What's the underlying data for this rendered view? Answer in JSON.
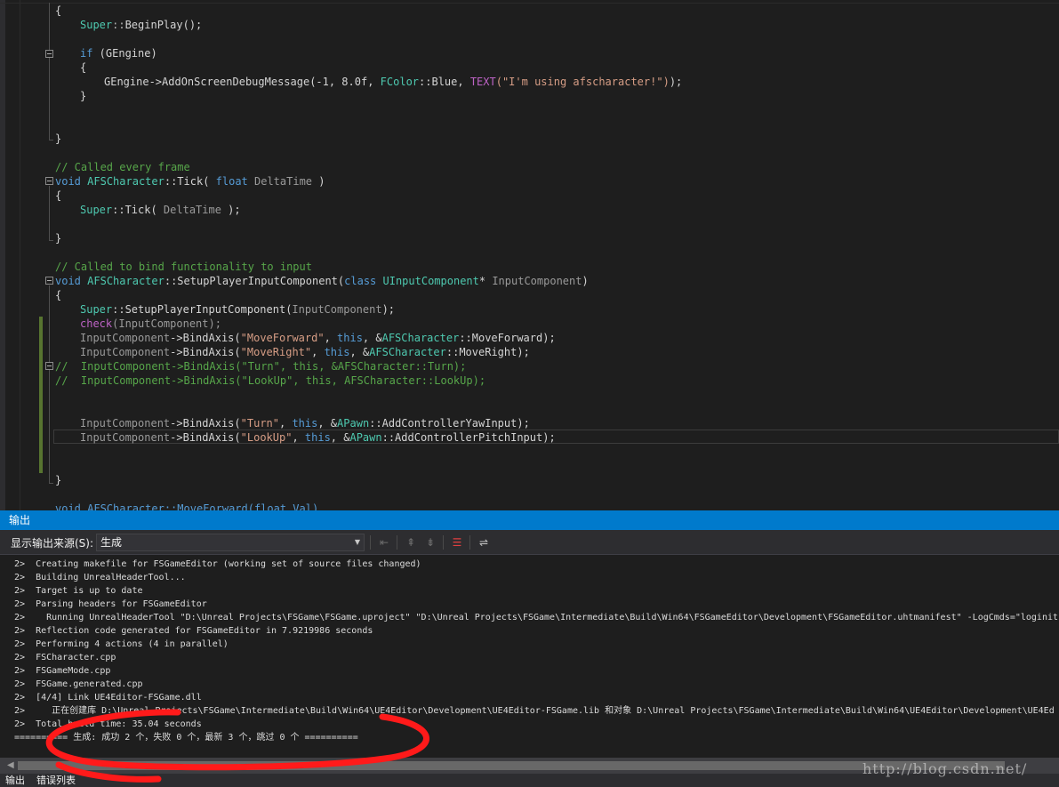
{
  "editor": {
    "lines": {
      "l1": "{",
      "super_beginplay": [
        "Super",
        "::",
        "BeginPlay",
        "();"
      ],
      "if_kw": "if",
      "if_rest": " (GEngine)",
      "open2": "{",
      "debug_call": "GEngine->AddOnScreenDebugMessage(-1, 8.0f, ",
      "fcolor": "FColor",
      "blue": "::Blue, ",
      "text_macro": "TEXT",
      "text_str": "(\"I'm using afscharacter!\")",
      "debug_end": ");",
      "close2": "}",
      "close1": "}",
      "comment_tick": "// Called every frame",
      "tick_void": "void",
      "tick_cls": "AFSCharacter",
      "tick_name": "::Tick( ",
      "tick_float": "float",
      "tick_param": " DeltaTime",
      "tick_close": " )",
      "open_tick": "{",
      "super_tick_a": "Super",
      "super_tick_b": "::Tick( ",
      "super_tick_param": "DeltaTime",
      "super_tick_c": " );",
      "close_tick": "}",
      "comment_bind": "// Called to bind functionality to input",
      "spic_void": "void",
      "spic_cls": "AFSCharacter",
      "spic_name": "::SetupPlayerInputComponent(",
      "spic_class": "class",
      "spic_type": "UInputComponent",
      "spic_star": "* ",
      "spic_param": "InputComponent",
      "spic_close": ")",
      "open_spic": "{",
      "super_spic_a": "Super",
      "super_spic_b": "::SetupPlayerInputComponent(",
      "super_spic_param": "InputComponent",
      "super_spic_c": ");",
      "check_kw": "check",
      "check_rest": "(InputComponent);",
      "ba1_a": "InputComponent",
      "ba1_b": "->BindAxis(",
      "ba1_str": "\"MoveForward\"",
      "ba1_c": ", ",
      "ba1_this": "this",
      "ba1_d": ", &",
      "ba1_cls": "AFSCharacter",
      "ba1_e": "::MoveForward);",
      "ba2_a": "InputComponent",
      "ba2_b": "->BindAxis(",
      "ba2_str": "\"MoveRight\"",
      "ba2_c": ", ",
      "ba2_this": "this",
      "ba2_d": ", &",
      "ba2_cls": "AFSCharacter",
      "ba2_e": "::MoveRight);",
      "cm_turn": "//  InputComponent->BindAxis(\"Turn\", this, &AFSCharacter::Turn);",
      "cm_lookup": "//  InputComponent->BindAxis(\"LookUp\", this, AFSCharacter::LookUp);",
      "ba3_a": "InputComponent",
      "ba3_b": "->BindAxis(",
      "ba3_str": "\"Turn\"",
      "ba3_c": ", ",
      "ba3_this": "this",
      "ba3_d": ", &",
      "ba3_cls": "APawn",
      "ba3_e": "::AddControllerYawInput);",
      "ba4_a": "InputComponent",
      "ba4_b": "->BindAxis(",
      "ba4_str": "\"LookUp\"",
      "ba4_c": ", ",
      "ba4_this": "this",
      "ba4_d": ", &",
      "ba4_cls": "APawn",
      "ba4_e": "::AddControllerPitchInput);",
      "close_spic": "}",
      "cut_line": "void AFSCharacter::MoveForward(float Val)"
    }
  },
  "output": {
    "title": "输出",
    "source_label": "显示输出来源(S):",
    "source_value": "生成",
    "lines": [
      "2>  Creating makefile for FSGameEditor (working set of source files changed)",
      "2>  Building UnrealHeaderTool...",
      "2>  Target is up to date",
      "2>  Parsing headers for FSGameEditor",
      "2>    Running UnrealHeaderTool \"D:\\Unreal Projects\\FSGame\\FSGame.uproject\" \"D:\\Unreal Projects\\FSGame\\Intermediate\\Build\\Win64\\FSGameEditor\\Development\\FSGameEditor.uhtmanifest\" -LogCmds=\"loginit",
      "2>  Reflection code generated for FSGameEditor in 7.9219986 seconds",
      "2>  Performing 4 actions (4 in parallel)",
      "2>  FSCharacter.cpp",
      "2>  FSGameMode.cpp",
      "2>  FSGame.generated.cpp",
      "2>  [4/4] Link UE4Editor-FSGame.dll",
      "2>     正在创建库 D:\\Unreal Projects\\FSGame\\Intermediate\\Build\\Win64\\UE4Editor\\Development\\UE4Editor-FSGame.lib 和对象 D:\\Unreal Projects\\FSGame\\Intermediate\\Build\\Win64\\UE4Editor\\Development\\UE4Ed",
      "2>  Total build time: 35.04 seconds",
      "========== 生成: 成功 2 个，失败 0 个，最新 3 个，跳过 0 个 =========="
    ]
  },
  "bottom_tabs": {
    "output": "输出",
    "error_list": "错误列表"
  },
  "watermark": "http://blog.csdn.net/",
  "colors": {
    "accent": "#007acc",
    "highlight_circle": "#ff1a1a"
  }
}
